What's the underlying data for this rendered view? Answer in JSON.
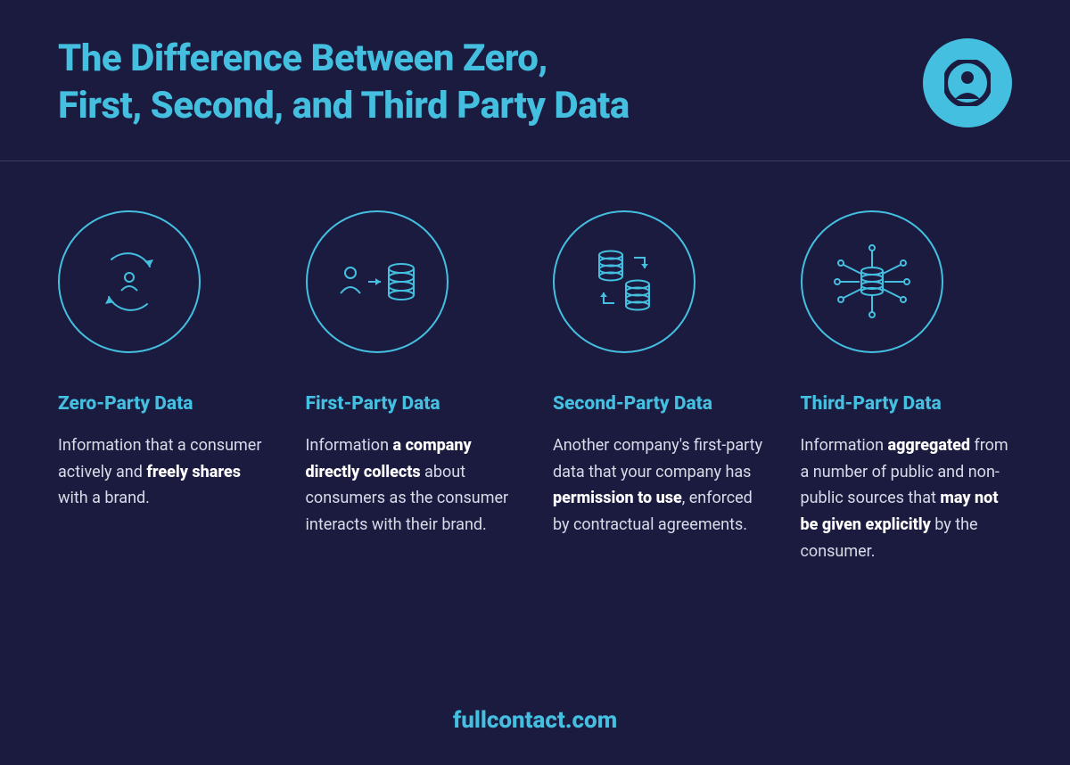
{
  "header": {
    "title_line1": "The Difference Between Zero,",
    "title_line2": "First, Second, and Third Party Data"
  },
  "columns": [
    {
      "icon": "cycle-person-icon",
      "title": "Zero-Party Data",
      "body_pre": "Information that a consumer actively and ",
      "body_bold": "freely shares",
      "body_post": " with a brand."
    },
    {
      "icon": "person-to-db-icon",
      "title": "First-Party Data",
      "body_pre": "Information ",
      "body_bold": "a company directly collects",
      "body_post": " about consumers as the consumer interacts with their brand."
    },
    {
      "icon": "db-sync-icon",
      "title": "Second-Party Data",
      "body_pre": "Another company's first-party data that your company has ",
      "body_bold": "permission to use",
      "body_post": ", enforced by contractual agreements."
    },
    {
      "icon": "db-network-icon",
      "title": "Third-Party Data",
      "body_pre": "Information ",
      "body_bold": "aggregated",
      "body_mid": " from a number of public and non-public sources that ",
      "body_bold2": "may not be given explicitly",
      "body_post": " by the consumer."
    }
  ],
  "footer": "fullcontact.com"
}
